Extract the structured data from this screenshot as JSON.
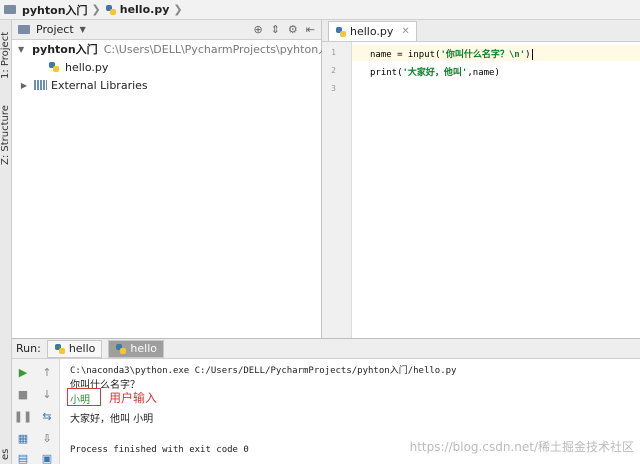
{
  "breadcrumb": {
    "project": "pyhton入门",
    "file": "hello.py"
  },
  "left_strip": {
    "project_tab": "1: Project",
    "structure_tab": "Z: Structure",
    "bottom_tab": "es"
  },
  "project_panel": {
    "header_label": "Project",
    "tree": {
      "root_name": "pyhton入门",
      "root_path": "C:\\Users\\DELL\\PycharmProjects\\pyhton入门",
      "file": "hello.py",
      "libraries": "External Libraries"
    }
  },
  "editor": {
    "tab_label": "hello.py",
    "line_numbers": [
      "1",
      "2",
      "3"
    ],
    "line1": {
      "code": "name = input(",
      "string": "'你叫什么名字？\\n'",
      "close": ")"
    },
    "line2": {
      "code": "print(",
      "string": "'大家好，他叫'",
      "close": ",name)"
    }
  },
  "run_panel": {
    "label": "Run:",
    "tab1": "hello",
    "tab2": "hello",
    "console": {
      "command": "C:\\naconda3\\python.exe C:/Users/DELL/PycharmProjects/pyhton入门/hello.py",
      "prompt": "你叫什么名字？",
      "user_input": "小明",
      "annotation": "用户输入",
      "greeting": "大家好，他叫 小明",
      "exit": "Process finished with exit code 0",
      "watermark": "https://blog.csdn.net/稀土掘金技术社区"
    }
  },
  "colors": {
    "string": "#0a7d2c",
    "annotation": "#d23b3b",
    "user_input": "#2f8a2f",
    "run_tab_active": "#9e9e9e"
  }
}
